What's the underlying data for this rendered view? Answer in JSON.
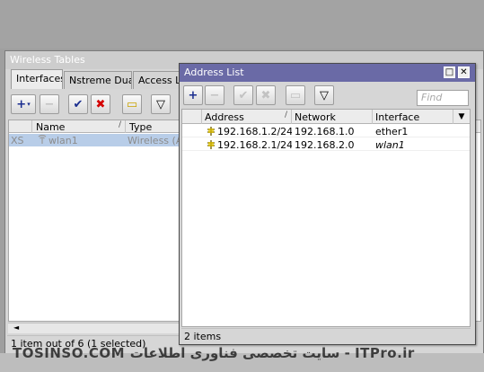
{
  "wireless_tables": {
    "title": "Wireless Tables",
    "tabs": [
      "Interfaces",
      "Nstreme Dual",
      "Access Lis"
    ],
    "toolbar": {
      "add": "+",
      "remove": "−",
      "enable": "✔",
      "disable": "✖",
      "comment": "▭",
      "filter": "▽"
    },
    "columns": [
      "Name",
      "Type"
    ],
    "rows": [
      {
        "flags": "XS",
        "name": "wlan1",
        "type": "Wireless (Ath"
      }
    ],
    "status": "1 item out of 6 (1 selected)",
    "scroll_left": "◄"
  },
  "address_list": {
    "title": "Address List",
    "window_buttons": {
      "maximize": "□",
      "close": "✕"
    },
    "toolbar": {
      "add": "+",
      "remove": "−",
      "enable": "✔",
      "disable": "✖",
      "comment": "▭",
      "filter": "▽"
    },
    "find_placeholder": "Find",
    "columns": {
      "address": "Address",
      "network": "Network",
      "interface": "Interface"
    },
    "rows": [
      {
        "address": "192.168.1.2/24",
        "network": "192.168.1.0",
        "interface": "ether1"
      },
      {
        "address": "192.168.2.1/24",
        "network": "192.168.2.0",
        "interface": "wlan1"
      }
    ],
    "status": "2 items"
  },
  "watermark": "TOSINSO.COM سایت تخصصی فناوری اطلاعات - ITPro.ir",
  "colors": {
    "active_title": "#6a6aa6",
    "inactive_title": "#cdcdcd",
    "add_blue": "#1a2d8f",
    "disable_red": "#d40000",
    "selection": "#b8cde8"
  }
}
